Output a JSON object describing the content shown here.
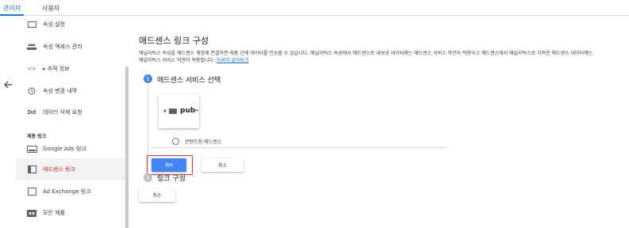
{
  "topbar": {
    "tabs": [
      {
        "label": "관리자",
        "active": true
      },
      {
        "label": "사용자",
        "active": false
      }
    ]
  },
  "sidebar": {
    "items": [
      {
        "label": "속성 설정",
        "icon": "settings-box-icon"
      },
      {
        "label": "속성 액세스 관리",
        "icon": "people-icon"
      },
      {
        "label": "▸ 추적 정보",
        "icon": "code-icon"
      },
      {
        "label": "속성 변경 내역",
        "icon": "history-icon"
      },
      {
        "label": "데이터 삭제 요청",
        "icon": "dd-icon"
      }
    ],
    "section_label": "제품 링크",
    "product_items": [
      {
        "label": "Google Ads 링크",
        "icon": "google-ads-icon",
        "selected": false
      },
      {
        "label": "애드센스 링크",
        "icon": "adsense-icon",
        "selected": true
      },
      {
        "label": "Ad Exchange 링크",
        "icon": "ad-exchange-icon",
        "selected": false
      },
      {
        "label": "모든 제품",
        "icon": "all-products-icon",
        "selected": false
      }
    ]
  },
  "main": {
    "title": "애드센스 링크 구성",
    "description_line1": "애널리틱스 속성을 애드센스 계정에 연결하면 제품 간에 데이터를 전송할 수 있습니다. 애널리틱스 속성에서 애드센스로 내보낸 데이터에는 애드센스 서비스 약관이 적용되고 애드센스에서 애널리틱스로 가져온 애드센스 데이터에는",
    "description_line2": "애널리틱스 서비스 약관이 적용됩니다.",
    "learn_more": "자세히 알아보기",
    "step1": {
      "number": "1",
      "title": "애드센스 서비스 선택"
    },
    "pub_label": "pub-",
    "radio_label": "콘텐츠용 애드센스",
    "continue_label": "계속",
    "cancel_label": "취소",
    "step2": {
      "number": "2",
      "title": "링크 구성"
    },
    "cancel2_label": "취소"
  },
  "colors": {
    "accent": "#4285f4",
    "highlight_border": "#e53935",
    "selected_text": "#c5221f"
  }
}
